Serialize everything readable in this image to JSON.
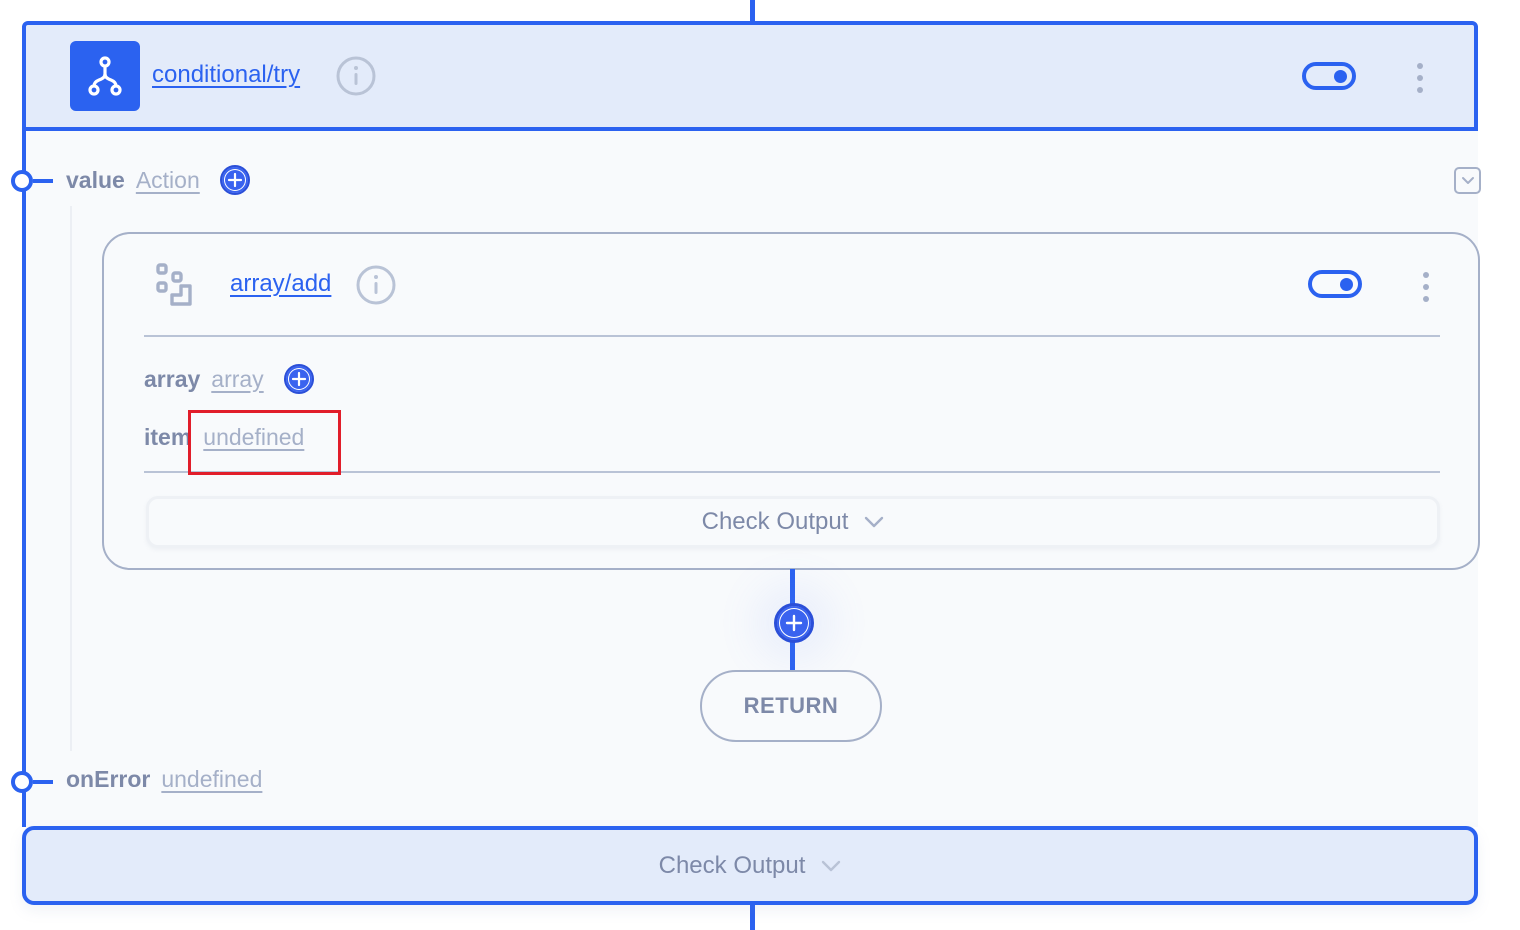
{
  "colors": {
    "accent": "#2b62f0",
    "header_bg": "#e3ebfa",
    "body_bg": "#f8fafc",
    "muted_text": "#7d89a8",
    "placeholder_text": "#a5b0c8",
    "highlight": "#e11d2a"
  },
  "outer_node": {
    "icon": "branch-icon",
    "title": "conditional/try",
    "info_icon": "info-icon",
    "toggle_enabled": true,
    "menu_icon": "kebab-menu-icon",
    "params": [
      {
        "name": "value",
        "value": "Action",
        "has_add_button": true
      },
      {
        "name": "onError",
        "value": "undefined",
        "has_add_button": false
      }
    ],
    "collapse_icon": "chevron-down-icon",
    "check_output_label": "Check Output"
  },
  "inner_node": {
    "icon": "array-blocks-icon",
    "title": "array/add",
    "info_icon": "info-icon",
    "toggle_enabled": true,
    "menu_icon": "kebab-menu-icon",
    "params": [
      {
        "name": "array",
        "value": "array",
        "has_add_button": true
      },
      {
        "name": "item",
        "value": "undefined",
        "has_add_button": false
      }
    ],
    "check_output_label": "Check Output"
  },
  "flow": {
    "add_step_icon": "plus-icon",
    "return_label": "RETURN"
  }
}
